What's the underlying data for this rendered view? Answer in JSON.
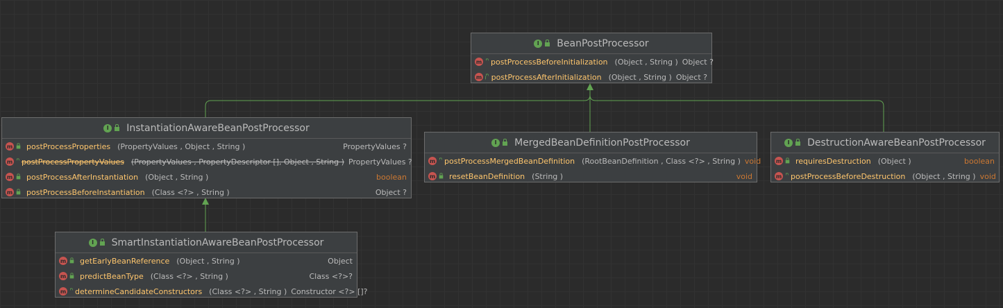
{
  "classes": {
    "bpp": {
      "name": "BeanPostProcessor",
      "methods": [
        {
          "name": "postProcessBeforeInitialization",
          "params": "(Object , String )",
          "ret": "Object ?"
        },
        {
          "name": "postProcessAfterInitialization",
          "params": "(Object , String )",
          "ret": "Object ?"
        }
      ]
    },
    "iabpp": {
      "name": "InstantiationAwareBeanPostProcessor",
      "methods": [
        {
          "name": "postProcessProperties",
          "params": "(PropertyValues , Object , String )",
          "ret": "PropertyValues ?"
        },
        {
          "name": "postProcessPropertyValues",
          "params": "(PropertyValues , PropertyDescriptor [], Object , String )",
          "ret": "PropertyValues ?",
          "deprecated": true
        },
        {
          "name": "postProcessAfterInstantiation",
          "params": "(Object , String )",
          "ret": "boolean"
        },
        {
          "name": "postProcessBeforeInstantiation",
          "params": "(Class <?> , String )",
          "ret": "Object ?"
        }
      ]
    },
    "mbdpp": {
      "name": "MergedBeanDefinitionPostProcessor",
      "methods": [
        {
          "name": "postProcessMergedBeanDefinition",
          "params": "(RootBeanDefinition , Class <?> , String )",
          "ret": "void"
        },
        {
          "name": "resetBeanDefinition",
          "params": "(String )",
          "ret": "void"
        }
      ]
    },
    "dabpp": {
      "name": "DestructionAwareBeanPostProcessor",
      "methods": [
        {
          "name": "requiresDestruction",
          "params": "(Object )",
          "ret": "boolean"
        },
        {
          "name": "postProcessBeforeDestruction",
          "params": "(Object , String )",
          "ret": "void"
        }
      ]
    },
    "siabpp": {
      "name": "SmartInstantiationAwareBeanPostProcessor",
      "methods": [
        {
          "name": "getEarlyBeanReference",
          "params": "(Object , String )",
          "ret": "Object"
        },
        {
          "name": "predictBeanType",
          "params": "(Class <?> , String )",
          "ret": "Class <?>?"
        },
        {
          "name": "determineCandidateConstructors",
          "params": "(Class <?> , String )",
          "ret": "Constructor <?> []?"
        }
      ]
    }
  },
  "icons": {
    "interface": "interface-icon",
    "method": "method-icon",
    "public": "lock-icon"
  },
  "colors": {
    "edge": "#62a352",
    "method_name": "#ffc66d",
    "keyword": "#cc7832"
  }
}
